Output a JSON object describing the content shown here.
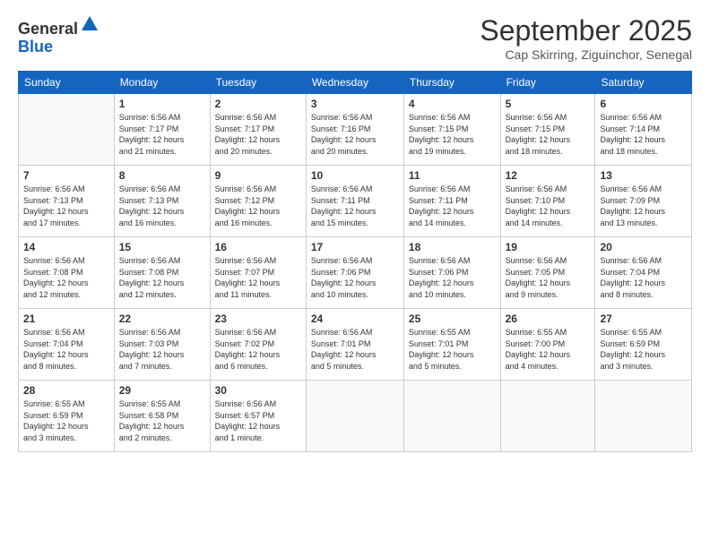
{
  "logo": {
    "general": "General",
    "blue": "Blue"
  },
  "header": {
    "month_year": "September 2025",
    "location": "Cap Skirring, Ziguinchor, Senegal"
  },
  "weekdays": [
    "Sunday",
    "Monday",
    "Tuesday",
    "Wednesday",
    "Thursday",
    "Friday",
    "Saturday"
  ],
  "weeks": [
    [
      {
        "num": "",
        "info": ""
      },
      {
        "num": "1",
        "info": "Sunrise: 6:56 AM\nSunset: 7:17 PM\nDaylight: 12 hours\nand 21 minutes."
      },
      {
        "num": "2",
        "info": "Sunrise: 6:56 AM\nSunset: 7:17 PM\nDaylight: 12 hours\nand 20 minutes."
      },
      {
        "num": "3",
        "info": "Sunrise: 6:56 AM\nSunset: 7:16 PM\nDaylight: 12 hours\nand 20 minutes."
      },
      {
        "num": "4",
        "info": "Sunrise: 6:56 AM\nSunset: 7:15 PM\nDaylight: 12 hours\nand 19 minutes."
      },
      {
        "num": "5",
        "info": "Sunrise: 6:56 AM\nSunset: 7:15 PM\nDaylight: 12 hours\nand 18 minutes."
      },
      {
        "num": "6",
        "info": "Sunrise: 6:56 AM\nSunset: 7:14 PM\nDaylight: 12 hours\nand 18 minutes."
      }
    ],
    [
      {
        "num": "7",
        "info": "Sunrise: 6:56 AM\nSunset: 7:13 PM\nDaylight: 12 hours\nand 17 minutes."
      },
      {
        "num": "8",
        "info": "Sunrise: 6:56 AM\nSunset: 7:13 PM\nDaylight: 12 hours\nand 16 minutes."
      },
      {
        "num": "9",
        "info": "Sunrise: 6:56 AM\nSunset: 7:12 PM\nDaylight: 12 hours\nand 16 minutes."
      },
      {
        "num": "10",
        "info": "Sunrise: 6:56 AM\nSunset: 7:11 PM\nDaylight: 12 hours\nand 15 minutes."
      },
      {
        "num": "11",
        "info": "Sunrise: 6:56 AM\nSunset: 7:11 PM\nDaylight: 12 hours\nand 14 minutes."
      },
      {
        "num": "12",
        "info": "Sunrise: 6:56 AM\nSunset: 7:10 PM\nDaylight: 12 hours\nand 14 minutes."
      },
      {
        "num": "13",
        "info": "Sunrise: 6:56 AM\nSunset: 7:09 PM\nDaylight: 12 hours\nand 13 minutes."
      }
    ],
    [
      {
        "num": "14",
        "info": "Sunrise: 6:56 AM\nSunset: 7:08 PM\nDaylight: 12 hours\nand 12 minutes."
      },
      {
        "num": "15",
        "info": "Sunrise: 6:56 AM\nSunset: 7:08 PM\nDaylight: 12 hours\nand 12 minutes."
      },
      {
        "num": "16",
        "info": "Sunrise: 6:56 AM\nSunset: 7:07 PM\nDaylight: 12 hours\nand 11 minutes."
      },
      {
        "num": "17",
        "info": "Sunrise: 6:56 AM\nSunset: 7:06 PM\nDaylight: 12 hours\nand 10 minutes."
      },
      {
        "num": "18",
        "info": "Sunrise: 6:56 AM\nSunset: 7:06 PM\nDaylight: 12 hours\nand 10 minutes."
      },
      {
        "num": "19",
        "info": "Sunrise: 6:56 AM\nSunset: 7:05 PM\nDaylight: 12 hours\nand 9 minutes."
      },
      {
        "num": "20",
        "info": "Sunrise: 6:56 AM\nSunset: 7:04 PM\nDaylight: 12 hours\nand 8 minutes."
      }
    ],
    [
      {
        "num": "21",
        "info": "Sunrise: 6:56 AM\nSunset: 7:04 PM\nDaylight: 12 hours\nand 8 minutes."
      },
      {
        "num": "22",
        "info": "Sunrise: 6:56 AM\nSunset: 7:03 PM\nDaylight: 12 hours\nand 7 minutes."
      },
      {
        "num": "23",
        "info": "Sunrise: 6:56 AM\nSunset: 7:02 PM\nDaylight: 12 hours\nand 6 minutes."
      },
      {
        "num": "24",
        "info": "Sunrise: 6:56 AM\nSunset: 7:01 PM\nDaylight: 12 hours\nand 5 minutes."
      },
      {
        "num": "25",
        "info": "Sunrise: 6:55 AM\nSunset: 7:01 PM\nDaylight: 12 hours\nand 5 minutes."
      },
      {
        "num": "26",
        "info": "Sunrise: 6:55 AM\nSunset: 7:00 PM\nDaylight: 12 hours\nand 4 minutes."
      },
      {
        "num": "27",
        "info": "Sunrise: 6:55 AM\nSunset: 6:59 PM\nDaylight: 12 hours\nand 3 minutes."
      }
    ],
    [
      {
        "num": "28",
        "info": "Sunrise: 6:55 AM\nSunset: 6:59 PM\nDaylight: 12 hours\nand 3 minutes."
      },
      {
        "num": "29",
        "info": "Sunrise: 6:55 AM\nSunset: 6:58 PM\nDaylight: 12 hours\nand 2 minutes."
      },
      {
        "num": "30",
        "info": "Sunrise: 6:56 AM\nSunset: 6:57 PM\nDaylight: 12 hours\nand 1 minute."
      },
      {
        "num": "",
        "info": ""
      },
      {
        "num": "",
        "info": ""
      },
      {
        "num": "",
        "info": ""
      },
      {
        "num": "",
        "info": ""
      }
    ]
  ]
}
